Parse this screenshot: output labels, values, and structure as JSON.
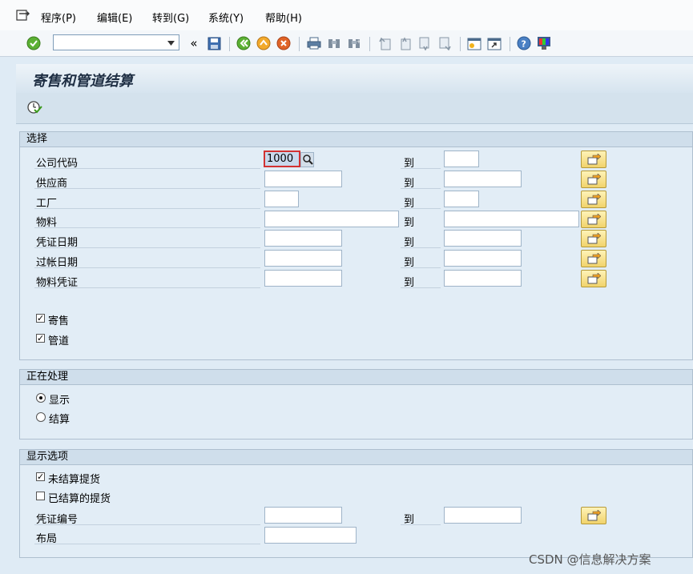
{
  "menu": {
    "items": [
      "程序(P)",
      "编辑(E)",
      "转到(G)",
      "系统(Y)",
      "帮助(H)"
    ]
  },
  "toolbar": {
    "command_value": "",
    "icons": [
      "enter-icon",
      "command-dropdown-icon",
      "collapse-icon",
      "save-icon",
      "back-icon",
      "exit-icon",
      "cancel-icon",
      "print-icon",
      "find-icon",
      "find-next-icon",
      "first-page-icon",
      "previous-page-icon",
      "next-page-icon",
      "last-page-icon",
      "create-session-icon",
      "shortcut-icon",
      "help-icon",
      "customize-layout-icon"
    ]
  },
  "page": {
    "title": "寄售和管道结算"
  },
  "selection": {
    "header": "选择",
    "to_label": "到",
    "rows": [
      {
        "label": "公司代码",
        "from": "1000",
        "to": ""
      },
      {
        "label": "供应商",
        "from": "",
        "to": ""
      },
      {
        "label": "工厂",
        "from": "",
        "to": ""
      },
      {
        "label": "物料",
        "from": "",
        "to": ""
      },
      {
        "label": "凭证日期",
        "from": "",
        "to": ""
      },
      {
        "label": "过帐日期",
        "from": "",
        "to": ""
      },
      {
        "label": "物料凭证",
        "from": "",
        "to": ""
      }
    ],
    "checkboxes": [
      {
        "label": "寄售",
        "checked": true
      },
      {
        "label": "管道",
        "checked": true
      }
    ]
  },
  "processing": {
    "header": "正在处理",
    "options": [
      {
        "label": "显示",
        "selected": true
      },
      {
        "label": "结算",
        "selected": false
      }
    ]
  },
  "display": {
    "header": "显示选项",
    "checkboxes": [
      {
        "label": "未结算提货",
        "checked": true
      },
      {
        "label": "已结算的提货",
        "checked": false
      }
    ],
    "doc_number_label": "凭证编号",
    "doc_number_from": "",
    "doc_number_to": "",
    "layout_label": "布局",
    "layout_value": ""
  },
  "watermark": "CSDN @信息解决方案"
}
